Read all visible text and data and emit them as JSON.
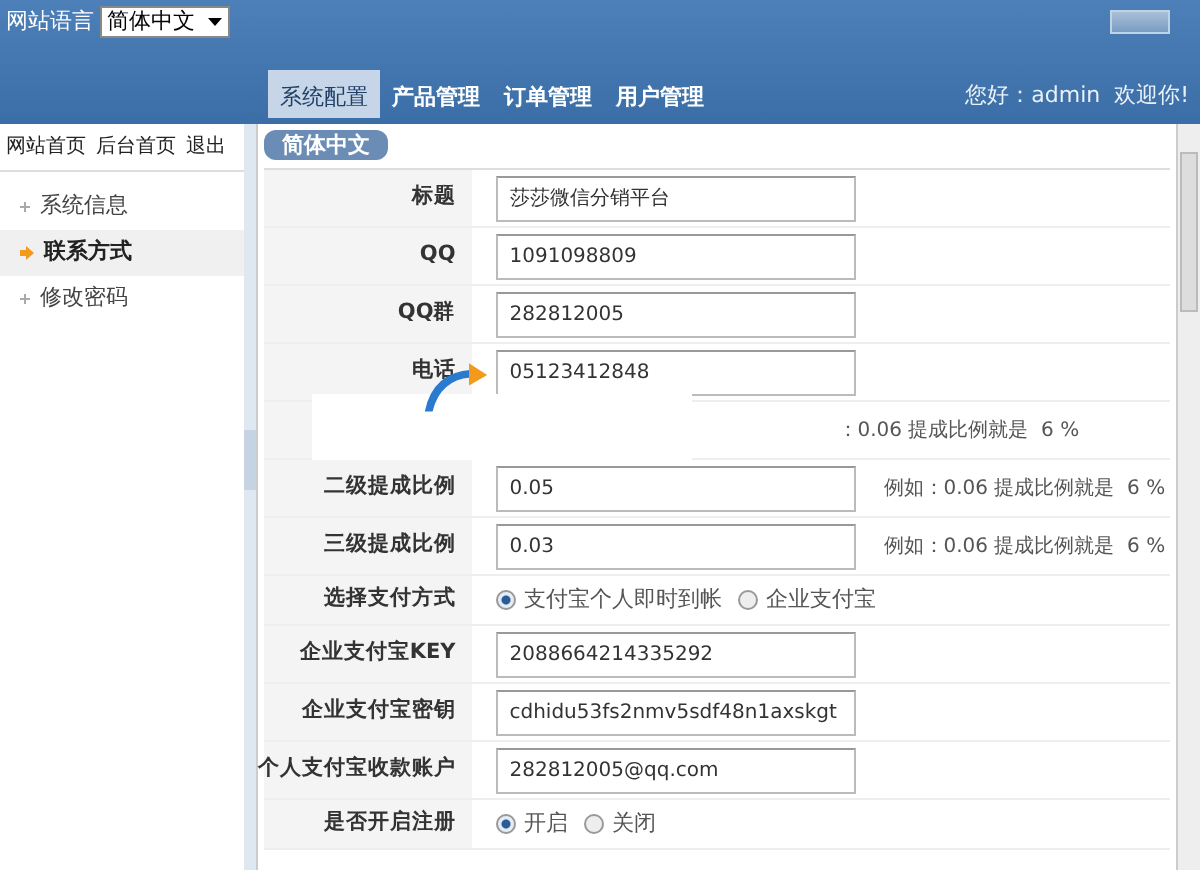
{
  "language_bar": {
    "label": "网站语言",
    "selected_language": "简体中文"
  },
  "nav_tabs": [
    {
      "label": "系统配置",
      "selected": true
    },
    {
      "label": "产品管理",
      "selected": false
    },
    {
      "label": "订单管理",
      "selected": false
    },
    {
      "label": "用户管理",
      "selected": false
    }
  ],
  "greeting": "您好：admin  欢迎你!",
  "top_links": [
    "网站首页",
    "后台首页",
    "退出"
  ],
  "sidebar": {
    "items": [
      {
        "label": "系统信息",
        "selected": false
      },
      {
        "label": "联系方式",
        "selected": true
      },
      {
        "label": "修改密码",
        "selected": false
      }
    ]
  },
  "panel_tab": "简体中文",
  "form": {
    "rows": [
      {
        "kind": "input",
        "label": "标题",
        "value": "莎莎微信分销平台"
      },
      {
        "kind": "input",
        "label": "QQ",
        "value": "1091098809"
      },
      {
        "kind": "input",
        "label": "QQ群",
        "value": "282812005"
      },
      {
        "kind": "input",
        "label": "电话",
        "value": "05123412848"
      },
      {
        "kind": "covered",
        "hint": "：0.06 提成比例就是  6 %"
      },
      {
        "kind": "input",
        "label": "二级提成比例",
        "value": "0.05",
        "hint": "例如：0.06 提成比例就是  6 %"
      },
      {
        "kind": "input",
        "label": "三级提成比例",
        "value": "0.03",
        "hint": "例如：0.06 提成比例就是  6 %"
      },
      {
        "kind": "radio",
        "label": "选择支付方式",
        "options": [
          {
            "label": "支付宝个人即时到帐",
            "selected": true
          },
          {
            "label": "企业支付宝",
            "selected": false
          }
        ]
      },
      {
        "kind": "input",
        "label": "企业支付宝KEY",
        "value": "2088664214335292"
      },
      {
        "kind": "input",
        "label": "企业支付宝密钥",
        "value": "cdhidu53fs2nmv5sdf48n1axskgt"
      },
      {
        "kind": "input",
        "label": "个人支付宝收款账户",
        "value": "282812005@qq.com"
      },
      {
        "kind": "radio",
        "label": "是否开启注册",
        "options": [
          {
            "label": "开启",
            "selected": true
          },
          {
            "label": "关闭",
            "selected": false
          }
        ]
      }
    ]
  }
}
